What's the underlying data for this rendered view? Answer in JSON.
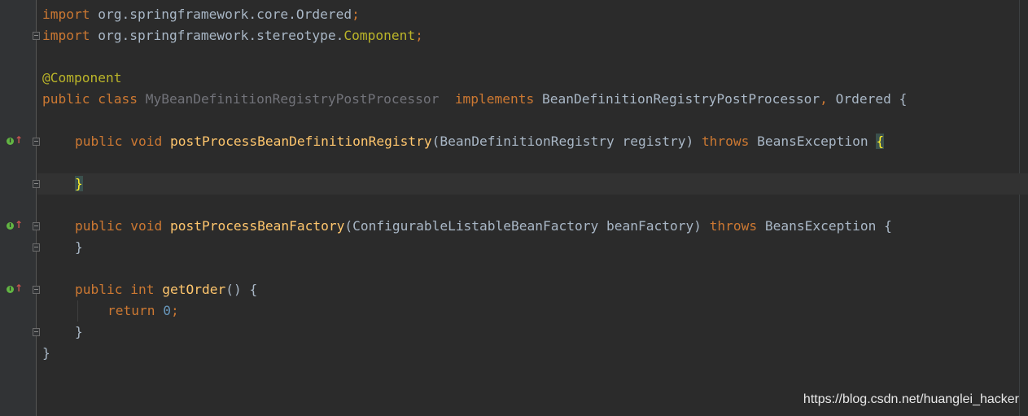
{
  "code": {
    "import_kw": "import",
    "import1_pkg": " org.springframework.core.Ordered",
    "import2_pkg": " org.springframework.stereotype.",
    "import2_cls": "Component",
    "semicolon": ";",
    "annotation": "@Component",
    "public": "public",
    "class": "class",
    "class_name": "MyBeanDefinitionRegistryPostProcessor",
    "implements": "implements",
    "iface1": "BeanDefinitionRegistryPostProcessor",
    "comma": ",",
    "iface2": "Ordered",
    "open_brace": "{",
    "close_brace": "}",
    "void": "void",
    "int": "int",
    "throws": "throws",
    "m1_name": "postProcessBeanDefinitionRegistry",
    "m1_params": "(BeanDefinitionRegistry registry)",
    "exception": "BeansException",
    "m2_name": "postProcessBeanFactory",
    "m2_params": "(ConfigurableListableBeanFactory beanFactory)",
    "m3_name": "getOrder",
    "m3_params": "()",
    "return_kw": "return",
    "zero": "0"
  },
  "watermark": "https://blog.csdn.net/huanglei_hacker",
  "colors": {
    "background": "#2b2b2b",
    "keyword": "#cc7832",
    "annotation": "#bbb529",
    "method": "#ffc66d",
    "number": "#6897bb",
    "default_text": "#a9b7c6"
  }
}
